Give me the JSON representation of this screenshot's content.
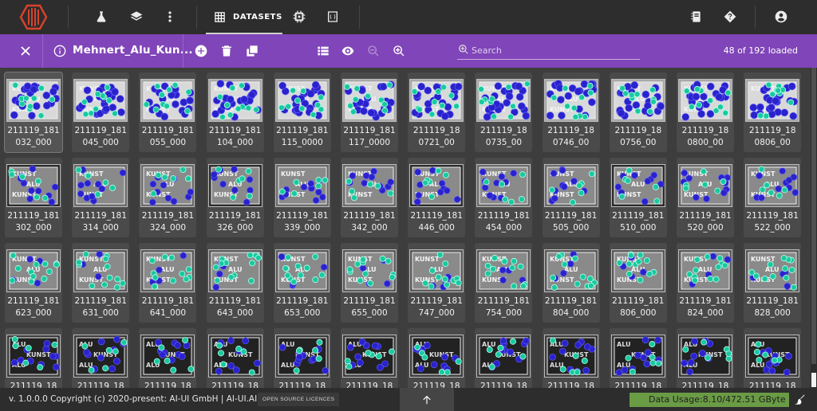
{
  "nav": {
    "datasets_label": "DATASETS"
  },
  "toolbar": {
    "dataset_title": "Mehnert_Alu_Kun...",
    "loaded": "48 of 192 loaded"
  },
  "search": {
    "placeholder": "Search",
    "value": ""
  },
  "grid": {
    "selected_index": 0,
    "items": [
      {
        "line1": "211119_181",
        "line2": "032_000",
        "variant": 1
      },
      {
        "line1": "211119_181",
        "line2": "045_000",
        "variant": 1
      },
      {
        "line1": "211119_181",
        "line2": "055_000",
        "variant": 1
      },
      {
        "line1": "211119_181",
        "line2": "104_000",
        "variant": 1
      },
      {
        "line1": "211119_181",
        "line2": "115_0000",
        "variant": 1
      },
      {
        "line1": "211119_181",
        "line2": "117_0000",
        "variant": 1
      },
      {
        "line1": "211119_18",
        "line2": "0721_00",
        "variant": 1
      },
      {
        "line1": "211119_18",
        "line2": "0735_00",
        "variant": 1
      },
      {
        "line1": "211119_18",
        "line2": "0746_00",
        "variant": 1
      },
      {
        "line1": "211119_18",
        "line2": "0756_00",
        "variant": 1
      },
      {
        "line1": "211119_18",
        "line2": "0800_00",
        "variant": 1
      },
      {
        "line1": "211119_18",
        "line2": "0806_00",
        "variant": 1
      },
      {
        "line1": "211119_181",
        "line2": "302_000",
        "variant": 2
      },
      {
        "line1": "211119_181",
        "line2": "314_000",
        "variant": 2
      },
      {
        "line1": "211119_181",
        "line2": "324_000",
        "variant": 2
      },
      {
        "line1": "211119_181",
        "line2": "326_000",
        "variant": 2
      },
      {
        "line1": "211119_181",
        "line2": "339_000",
        "variant": 2
      },
      {
        "line1": "211119_181",
        "line2": "342_000",
        "variant": 2
      },
      {
        "line1": "211119_181",
        "line2": "446_000",
        "variant": 2
      },
      {
        "line1": "211119_181",
        "line2": "454_000",
        "variant": 2
      },
      {
        "line1": "211119_181",
        "line2": "505_000",
        "variant": 2
      },
      {
        "line1": "211119_181",
        "line2": "510_000",
        "variant": 2
      },
      {
        "line1": "211119_181",
        "line2": "520_000",
        "variant": 2
      },
      {
        "line1": "211119_181",
        "line2": "522_000",
        "variant": 2
      },
      {
        "line1": "211119_181",
        "line2": "623_000",
        "variant": 3
      },
      {
        "line1": "211119_181",
        "line2": "631_000",
        "variant": 3
      },
      {
        "line1": "211119_181",
        "line2": "641_000",
        "variant": 3
      },
      {
        "line1": "211119_181",
        "line2": "643_000",
        "variant": 3
      },
      {
        "line1": "211119_181",
        "line2": "653_000",
        "variant": 3
      },
      {
        "line1": "211119_181",
        "line2": "655_000",
        "variant": 3
      },
      {
        "line1": "211119_181",
        "line2": "747_000",
        "variant": 3
      },
      {
        "line1": "211119_181",
        "line2": "754_000",
        "variant": 3
      },
      {
        "line1": "211119_181",
        "line2": "804_000",
        "variant": 3
      },
      {
        "line1": "211119_181",
        "line2": "806_000",
        "variant": 3
      },
      {
        "line1": "211119_181",
        "line2": "824_000",
        "variant": 3
      },
      {
        "line1": "211119_181",
        "line2": "828_000",
        "variant": 3
      },
      {
        "line1": "211119_18",
        "line2": "",
        "variant": 4
      },
      {
        "line1": "211119_18",
        "line2": "",
        "variant": 4
      },
      {
        "line1": "211119_18",
        "line2": "",
        "variant": 4
      },
      {
        "line1": "211119_18",
        "line2": "",
        "variant": 4
      },
      {
        "line1": "211119_18",
        "line2": "",
        "variant": 4
      },
      {
        "line1": "211119_18",
        "line2": "",
        "variant": 4
      },
      {
        "line1": "211119_18",
        "line2": "",
        "variant": 4
      },
      {
        "line1": "211119_18",
        "line2": "",
        "variant": 4
      },
      {
        "line1": "211119_18",
        "line2": "",
        "variant": 4
      },
      {
        "line1": "211119_18",
        "line2": "",
        "variant": 4
      },
      {
        "line1": "211119_18",
        "line2": "",
        "variant": 4
      },
      {
        "line1": "211119_18",
        "line2": "",
        "variant": 4
      }
    ]
  },
  "thumbnail_text": {
    "kunst": "KUNST",
    "alu": "ALU"
  },
  "footer": {
    "copyright": "v. 1.0.0.0 Copyright (c) 2020-present: AI-UI GmbH | AI-UI.AI",
    "licences": "OPEN SOURCE LICENCES",
    "usage": "Data Usage:8.10/472.51 GByte"
  },
  "colors": {
    "toolbar_purple": "#8045b8",
    "usage_green": "#6a9b45",
    "logo_red": "#d9432c",
    "annotation_blue": "#2a22cc",
    "annotation_teal": "#19c9a0"
  },
  "icons": {
    "topbar": [
      "logo",
      "flask-icon",
      "layers-icon",
      "more-vert-icon",
      "grid-icon",
      "chip-icon",
      "braces-icon",
      "notebook-icon",
      "help-icon",
      "account-icon"
    ],
    "toolbar": [
      "close-icon",
      "info-icon",
      "add-circle-icon",
      "delete-icon",
      "copy-icon",
      "list-view-icon",
      "eye-icon",
      "zoom-out-icon",
      "zoom-in-icon",
      "search-icon"
    ],
    "footer": [
      "arrow-up-icon",
      "brush-icon"
    ]
  }
}
